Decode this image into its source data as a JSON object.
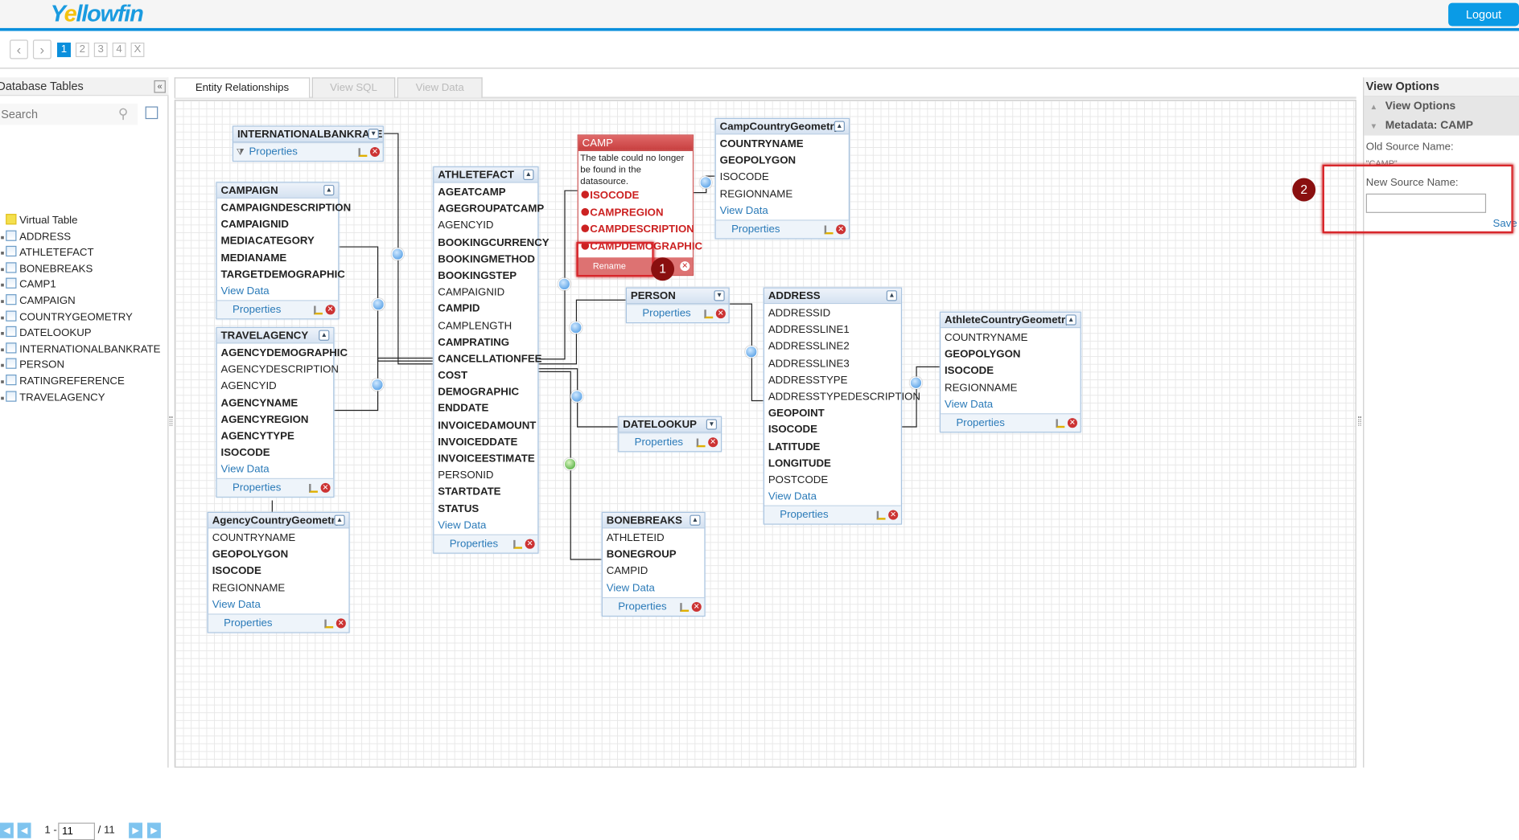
{
  "app": {
    "logo_text": "Yellowfin",
    "logout_label": "Logout",
    "accent_color": "#0a8fdc"
  },
  "steps": {
    "prev_icon": "chevron-left-icon",
    "next_icon": "chevron-right-icon",
    "items": [
      "1",
      "2",
      "3",
      "4",
      "X"
    ],
    "active": "1"
  },
  "left_panel": {
    "title": "Database Tables",
    "collapse_icon": "double-chevron-left-icon",
    "search_placeholder": "Search",
    "tables": [
      "Virtual Table",
      "ADDRESS",
      "ATHLETEFACT",
      "BONEBREAKS",
      "CAMP1",
      "CAMPAIGN",
      "COUNTRYGEOMETRY",
      "DATELOOKUP",
      "INTERNATIONALBANKRATE",
      "PERSON",
      "RATINGREFERENCE",
      "TRAVELAGENCY"
    ],
    "pager": {
      "range_prefix": "1 -",
      "current": "11",
      "total": "/ 11"
    }
  },
  "tabs": [
    {
      "label": "Entity Relationships",
      "active": true
    },
    {
      "label": "View SQL",
      "active": false
    },
    {
      "label": "View Data",
      "active": false
    }
  ],
  "diagram": {
    "view_data_label": "View Data",
    "properties_label": "Properties",
    "tables": [
      {
        "name": "INTERNATIONALBANKRATE",
        "collapsed": true,
        "filter": true,
        "fields": []
      },
      {
        "name": "CAMPAIGN",
        "collapsed": false,
        "fields": [
          {
            "n": "CAMPAIGNDESCRIPTION",
            "b": true
          },
          {
            "n": "CAMPAIGNID",
            "b": true
          },
          {
            "n": "MEDIACATEGORY",
            "b": true
          },
          {
            "n": "MEDIANAME",
            "b": true
          },
          {
            "n": "TARGETDEMOGRAPHIC",
            "b": true
          }
        ]
      },
      {
        "name": "TRAVELAGENCY",
        "collapsed": false,
        "fields": [
          {
            "n": "AGENCYDEMOGRAPHIC",
            "b": true
          },
          {
            "n": "AGENCYDESCRIPTION",
            "b": false
          },
          {
            "n": "AGENCYID",
            "b": false
          },
          {
            "n": "AGENCYNAME",
            "b": true
          },
          {
            "n": "AGENCYREGION",
            "b": true
          },
          {
            "n": "AGENCYTYPE",
            "b": true
          },
          {
            "n": "ISOCODE",
            "b": true
          }
        ]
      },
      {
        "name": "AgencyCountryGeometry",
        "collapsed": false,
        "fields": [
          {
            "n": "COUNTRYNAME",
            "b": false
          },
          {
            "n": "GEOPOLYGON",
            "b": true
          },
          {
            "n": "ISOCODE",
            "b": true
          },
          {
            "n": "REGIONNAME",
            "b": false
          }
        ]
      },
      {
        "name": "ATHLETEFACT",
        "collapsed": false,
        "fields": [
          {
            "n": "AGEATCAMP",
            "b": true
          },
          {
            "n": "AGEGROUPATCAMP",
            "b": true
          },
          {
            "n": "AGENCYID",
            "b": false
          },
          {
            "n": "BOOKINGCURRENCY",
            "b": true
          },
          {
            "n": "BOOKINGMETHOD",
            "b": true
          },
          {
            "n": "BOOKINGSTEP",
            "b": true
          },
          {
            "n": "CAMPAIGNID",
            "b": false
          },
          {
            "n": "CAMPID",
            "b": true
          },
          {
            "n": "CAMPLENGTH",
            "b": false
          },
          {
            "n": "CAMPRATING",
            "b": true
          },
          {
            "n": "CANCELLATIONFEE",
            "b": true
          },
          {
            "n": "COST",
            "b": true
          },
          {
            "n": "DEMOGRAPHIC",
            "b": true
          },
          {
            "n": "ENDDATE",
            "b": true
          },
          {
            "n": "INVOICEDAMOUNT",
            "b": true
          },
          {
            "n": "INVOICEDDATE",
            "b": true
          },
          {
            "n": "INVOICEESTIMATE",
            "b": true
          },
          {
            "n": "PERSONID",
            "b": false
          },
          {
            "n": "STARTDATE",
            "b": true
          },
          {
            "n": "STATUS",
            "b": true
          }
        ]
      },
      {
        "name": "CampCountryGeometry",
        "collapsed": false,
        "fields": [
          {
            "n": "COUNTRYNAME",
            "b": true
          },
          {
            "n": "GEOPOLYGON",
            "b": true
          },
          {
            "n": "ISOCODE",
            "b": false
          },
          {
            "n": "REGIONNAME",
            "b": false
          }
        ]
      },
      {
        "name": "PERSON",
        "collapsed": true,
        "fields": []
      },
      {
        "name": "ADDRESS",
        "collapsed": false,
        "fields": [
          {
            "n": "ADDRESSID",
            "b": false
          },
          {
            "n": "ADDRESSLINE1",
            "b": false
          },
          {
            "n": "ADDRESSLINE2",
            "b": false
          },
          {
            "n": "ADDRESSLINE3",
            "b": false
          },
          {
            "n": "ADDRESSTYPE",
            "b": false
          },
          {
            "n": "ADDRESSTYPEDESCRIPTION",
            "b": false
          },
          {
            "n": "GEOPOINT",
            "b": true
          },
          {
            "n": "ISOCODE",
            "b": true
          },
          {
            "n": "LATITUDE",
            "b": true
          },
          {
            "n": "LONGITUDE",
            "b": true
          },
          {
            "n": "POSTCODE",
            "b": false
          }
        ]
      },
      {
        "name": "AthleteCountryGeometry",
        "collapsed": false,
        "fields": [
          {
            "n": "COUNTRYNAME",
            "b": false
          },
          {
            "n": "GEOPOLYGON",
            "b": true
          },
          {
            "n": "ISOCODE",
            "b": true
          },
          {
            "n": "REGIONNAME",
            "b": false
          }
        ]
      },
      {
        "name": "DATELOOKUP",
        "collapsed": true,
        "fields": []
      },
      {
        "name": "BONEBREAKS",
        "collapsed": false,
        "fields": [
          {
            "n": "ATHLETEID",
            "b": false
          },
          {
            "n": "BONEGROUP",
            "b": true
          },
          {
            "n": "CAMPID",
            "b": false
          }
        ]
      }
    ],
    "missing_table": {
      "name": "CAMP",
      "message": "The table could no longer be found in the datasource.",
      "fields": [
        "ISOCODE",
        "CAMPREGION",
        "CAMPDESCRIPTION",
        "CAMPDEMOGRAPHIC"
      ],
      "rename_label": "Rename",
      "error_color": "#c22222"
    },
    "callouts": [
      "1",
      "2"
    ]
  },
  "right_panel": {
    "title": "View Options",
    "sections": [
      {
        "label": "View Options",
        "icon": "chevron-up-icon"
      },
      {
        "label": "Metadata: CAMP",
        "icon": "chevron-down-icon"
      }
    ],
    "old_source_label": "Old Source Name:",
    "old_source_value": "\"CAMP\"",
    "new_source_label": "New Source Name:",
    "new_source_value": "",
    "save_label": "Save"
  }
}
